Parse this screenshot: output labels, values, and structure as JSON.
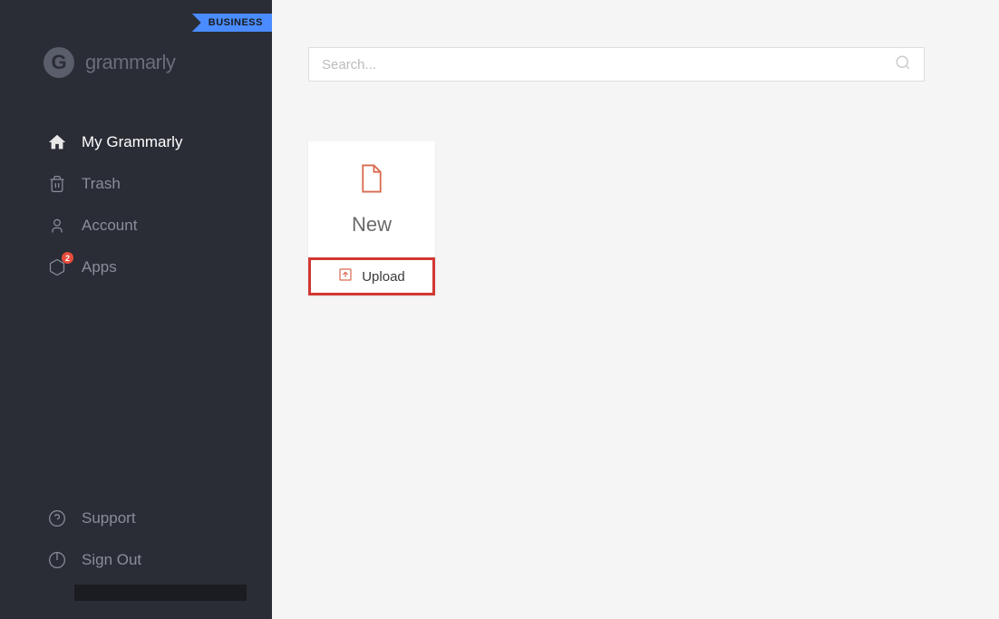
{
  "header": {
    "business_tag": "BUSINESS",
    "brand": "grammarly"
  },
  "sidebar": {
    "nav": [
      {
        "label": "My Grammarly",
        "icon": "home",
        "active": true
      },
      {
        "label": "Trash",
        "icon": "trash",
        "active": false
      },
      {
        "label": "Account",
        "icon": "account",
        "active": false
      },
      {
        "label": "Apps",
        "icon": "apps",
        "active": false,
        "badge": "2"
      }
    ],
    "bottom": [
      {
        "label": "Support",
        "icon": "support"
      },
      {
        "label": "Sign Out",
        "icon": "signout"
      }
    ]
  },
  "search": {
    "placeholder": "Search..."
  },
  "document_card": {
    "new_label": "New",
    "upload_label": "Upload"
  }
}
